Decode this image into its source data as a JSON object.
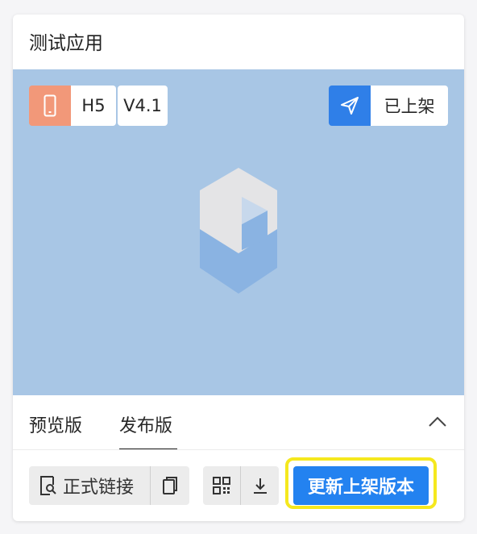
{
  "card": {
    "title": "测试应用",
    "badges": {
      "platform_icon": "phone-icon",
      "platform": "H5",
      "version": "V4.1",
      "status_icon": "send-icon",
      "status": "已上架"
    },
    "tabs": [
      {
        "label": "预览版",
        "active": false
      },
      {
        "label": "发布版",
        "active": true
      }
    ],
    "actions": {
      "official_link_label": "正式链接",
      "official_link_icon": "search-doc-icon",
      "copy_icon": "copy-icon",
      "qrcode_icon": "qrcode-icon",
      "download_icon": "download-icon",
      "update_button_label": "更新上架版本"
    }
  },
  "colors": {
    "preview_bg": "#a8c6e5",
    "platform_badge": "#f29879",
    "status_badge": "#2f7fe8",
    "primary": "#2382f0",
    "highlight": "#f5e81e"
  }
}
